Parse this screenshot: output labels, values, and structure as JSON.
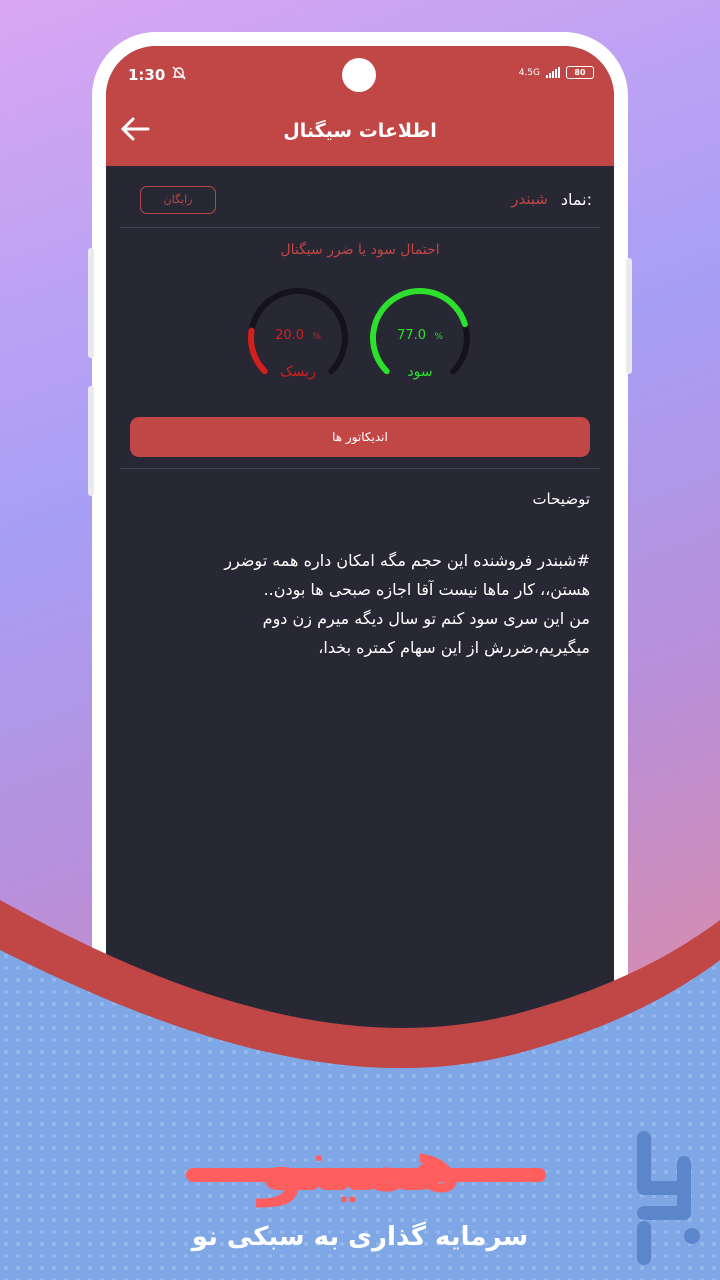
{
  "status_bar": {
    "time": "1:30",
    "mute_icon": "bell-off-icon",
    "network": "4.5G",
    "battery": "80"
  },
  "header": {
    "title": "اطلاعات سیگنال",
    "back_icon": "arrow-left-icon"
  },
  "symbol": {
    "label": "نماد:",
    "value": "شبندر",
    "badge": "رایگان"
  },
  "probability": {
    "title": "احتمال سود یا ضرر سیگنال",
    "profit": {
      "value": "77.0",
      "unit": "%",
      "label": "سود",
      "percent": 77,
      "color": "#2de02d"
    },
    "risk": {
      "value": "20.0",
      "unit": "%",
      "label": "ریسک",
      "percent": 20,
      "color": "#d41f1f"
    }
  },
  "indicators_button": "اندیکاتور ها",
  "description": {
    "title": "توضیحات",
    "lines": [
      "#شبندر فروشنده این حجم مگه امکان داره همه توضرر",
      "هستن،، کار ماها نیست آقا اجازه صبحی ها بودن..",
      "من این سری سود کنم تو سال دیگه میرم زن دوم",
      "میگیریم،ضررش از این سهام کمتره بخدا،"
    ]
  },
  "brand": {
    "name": "همینو",
    "tagline": "سرمایه گذاری به سبکی نو",
    "store_icon": "bazaar-logo-icon"
  },
  "colors": {
    "accent": "#c14646",
    "background": "#282734",
    "brand": "#ff5e5e"
  }
}
